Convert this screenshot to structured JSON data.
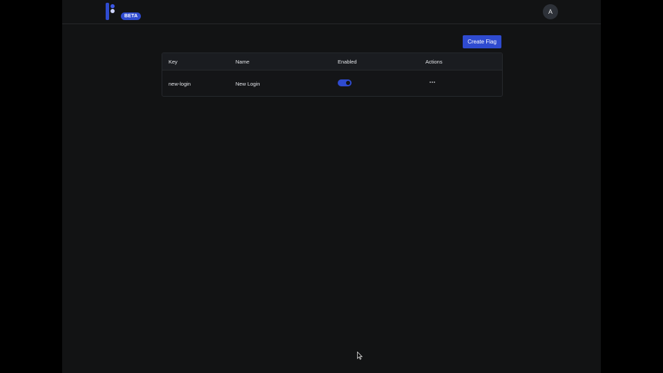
{
  "header": {
    "badge": "BETA",
    "avatar_initial": "A"
  },
  "toolbar": {
    "create_label": "Create Flag"
  },
  "table": {
    "columns": [
      "Key",
      "Name",
      "Enabled",
      "Actions"
    ],
    "rows": [
      {
        "key": "new-login",
        "name": "New Login",
        "enabled": true,
        "actions_icon": "more-horizontal-icon"
      }
    ]
  },
  "colors": {
    "accent": "#2f4bd0",
    "background": "#121314",
    "outer_background": "#000000"
  }
}
